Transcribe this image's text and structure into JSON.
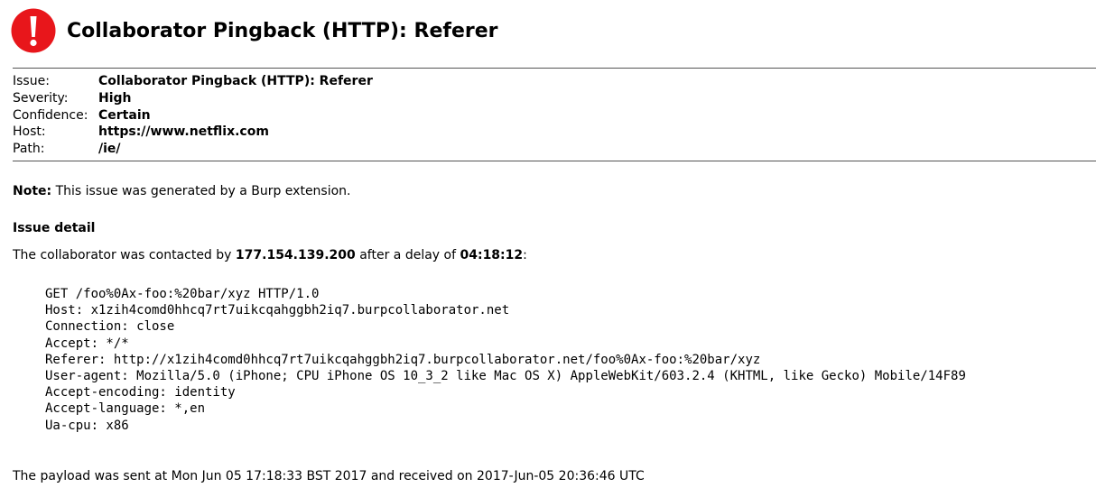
{
  "header": {
    "icon": "alert-exclamation-icon",
    "icon_color": "#e8161b",
    "title": "Collaborator Pingback (HTTP): Referer"
  },
  "summary": [
    {
      "label": "Issue:",
      "value": "Collaborator Pingback (HTTP): Referer"
    },
    {
      "label": "Severity:",
      "value": "High"
    },
    {
      "label": "Confidence:",
      "value": "Certain"
    },
    {
      "label": "Host:",
      "value": "https://www.netflix.com"
    },
    {
      "label": "Path:",
      "value": "/ie/"
    }
  ],
  "note": {
    "label": "Note:",
    "text": "This issue was generated by a Burp extension."
  },
  "issue_detail": {
    "heading": "Issue detail",
    "contact_prefix": "The collaborator was contacted by",
    "ip": "177.154.139.200",
    "delay_prefix": "after a delay of",
    "delay": "04:18:12",
    "delay_suffix": ":"
  },
  "request_lines": [
    "GET /foo%0Ax-foo:%20bar/xyz HTTP/1.0",
    "Host: x1zih4comd0hhcq7rt7uikcqahggbh2iq7.burpcollaborator.net",
    "Connection: close",
    "Accept: */*",
    "Referer: http://x1zih4comd0hhcq7rt7uikcqahggbh2iq7.burpcollaborator.net/foo%0Ax-foo:%20bar/xyz",
    "User-agent: Mozilla/5.0 (iPhone; CPU iPhone OS 10_3_2 like Mac OS X) AppleWebKit/603.2.4 (KHTML, like Gecko) Mobile/14F89",
    "Accept-encoding: identity",
    "Accept-language: *,en",
    "Ua-cpu: x86"
  ],
  "footer": {
    "text": "The payload was sent at Mon Jun 05 17:18:33 BST 2017 and received on 2017-Jun-05 20:36:46 UTC"
  }
}
